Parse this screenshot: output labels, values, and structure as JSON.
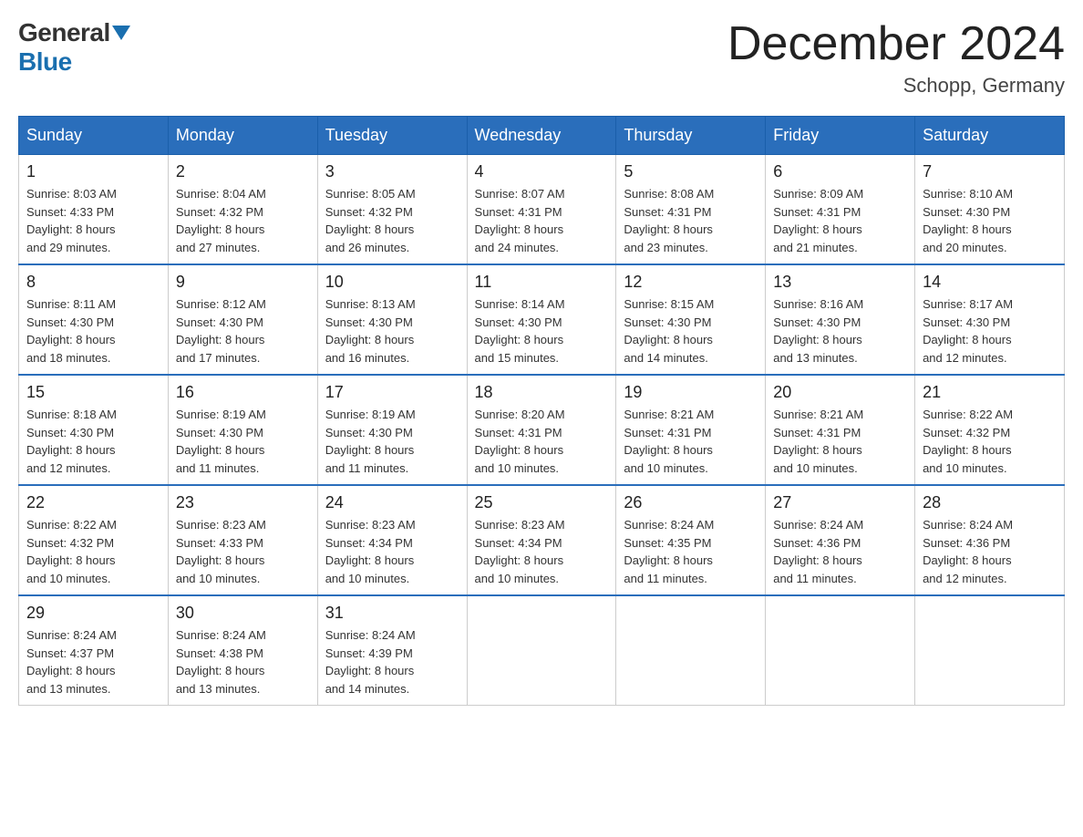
{
  "header": {
    "logo_general": "General",
    "logo_blue": "Blue",
    "month_title": "December 2024",
    "location": "Schopp, Germany"
  },
  "days_of_week": [
    "Sunday",
    "Monday",
    "Tuesday",
    "Wednesday",
    "Thursday",
    "Friday",
    "Saturday"
  ],
  "weeks": [
    [
      {
        "day": "1",
        "sunrise": "8:03 AM",
        "sunset": "4:33 PM",
        "daylight": "8 hours and 29 minutes."
      },
      {
        "day": "2",
        "sunrise": "8:04 AM",
        "sunset": "4:32 PM",
        "daylight": "8 hours and 27 minutes."
      },
      {
        "day": "3",
        "sunrise": "8:05 AM",
        "sunset": "4:32 PM",
        "daylight": "8 hours and 26 minutes."
      },
      {
        "day": "4",
        "sunrise": "8:07 AM",
        "sunset": "4:31 PM",
        "daylight": "8 hours and 24 minutes."
      },
      {
        "day": "5",
        "sunrise": "8:08 AM",
        "sunset": "4:31 PM",
        "daylight": "8 hours and 23 minutes."
      },
      {
        "day": "6",
        "sunrise": "8:09 AM",
        "sunset": "4:31 PM",
        "daylight": "8 hours and 21 minutes."
      },
      {
        "day": "7",
        "sunrise": "8:10 AM",
        "sunset": "4:30 PM",
        "daylight": "8 hours and 20 minutes."
      }
    ],
    [
      {
        "day": "8",
        "sunrise": "8:11 AM",
        "sunset": "4:30 PM",
        "daylight": "8 hours and 18 minutes."
      },
      {
        "day": "9",
        "sunrise": "8:12 AM",
        "sunset": "4:30 PM",
        "daylight": "8 hours and 17 minutes."
      },
      {
        "day": "10",
        "sunrise": "8:13 AM",
        "sunset": "4:30 PM",
        "daylight": "8 hours and 16 minutes."
      },
      {
        "day": "11",
        "sunrise": "8:14 AM",
        "sunset": "4:30 PM",
        "daylight": "8 hours and 15 minutes."
      },
      {
        "day": "12",
        "sunrise": "8:15 AM",
        "sunset": "4:30 PM",
        "daylight": "8 hours and 14 minutes."
      },
      {
        "day": "13",
        "sunrise": "8:16 AM",
        "sunset": "4:30 PM",
        "daylight": "8 hours and 13 minutes."
      },
      {
        "day": "14",
        "sunrise": "8:17 AM",
        "sunset": "4:30 PM",
        "daylight": "8 hours and 12 minutes."
      }
    ],
    [
      {
        "day": "15",
        "sunrise": "8:18 AM",
        "sunset": "4:30 PM",
        "daylight": "8 hours and 12 minutes."
      },
      {
        "day": "16",
        "sunrise": "8:19 AM",
        "sunset": "4:30 PM",
        "daylight": "8 hours and 11 minutes."
      },
      {
        "day": "17",
        "sunrise": "8:19 AM",
        "sunset": "4:30 PM",
        "daylight": "8 hours and 11 minutes."
      },
      {
        "day": "18",
        "sunrise": "8:20 AM",
        "sunset": "4:31 PM",
        "daylight": "8 hours and 10 minutes."
      },
      {
        "day": "19",
        "sunrise": "8:21 AM",
        "sunset": "4:31 PM",
        "daylight": "8 hours and 10 minutes."
      },
      {
        "day": "20",
        "sunrise": "8:21 AM",
        "sunset": "4:31 PM",
        "daylight": "8 hours and 10 minutes."
      },
      {
        "day": "21",
        "sunrise": "8:22 AM",
        "sunset": "4:32 PM",
        "daylight": "8 hours and 10 minutes."
      }
    ],
    [
      {
        "day": "22",
        "sunrise": "8:22 AM",
        "sunset": "4:32 PM",
        "daylight": "8 hours and 10 minutes."
      },
      {
        "day": "23",
        "sunrise": "8:23 AM",
        "sunset": "4:33 PM",
        "daylight": "8 hours and 10 minutes."
      },
      {
        "day": "24",
        "sunrise": "8:23 AM",
        "sunset": "4:34 PM",
        "daylight": "8 hours and 10 minutes."
      },
      {
        "day": "25",
        "sunrise": "8:23 AM",
        "sunset": "4:34 PM",
        "daylight": "8 hours and 10 minutes."
      },
      {
        "day": "26",
        "sunrise": "8:24 AM",
        "sunset": "4:35 PM",
        "daylight": "8 hours and 11 minutes."
      },
      {
        "day": "27",
        "sunrise": "8:24 AM",
        "sunset": "4:36 PM",
        "daylight": "8 hours and 11 minutes."
      },
      {
        "day": "28",
        "sunrise": "8:24 AM",
        "sunset": "4:36 PM",
        "daylight": "8 hours and 12 minutes."
      }
    ],
    [
      {
        "day": "29",
        "sunrise": "8:24 AM",
        "sunset": "4:37 PM",
        "daylight": "8 hours and 13 minutes."
      },
      {
        "day": "30",
        "sunrise": "8:24 AM",
        "sunset": "4:38 PM",
        "daylight": "8 hours and 13 minutes."
      },
      {
        "day": "31",
        "sunrise": "8:24 AM",
        "sunset": "4:39 PM",
        "daylight": "8 hours and 14 minutes."
      },
      null,
      null,
      null,
      null
    ]
  ],
  "labels": {
    "sunrise": "Sunrise: ",
    "sunset": "Sunset: ",
    "daylight": "Daylight: "
  }
}
